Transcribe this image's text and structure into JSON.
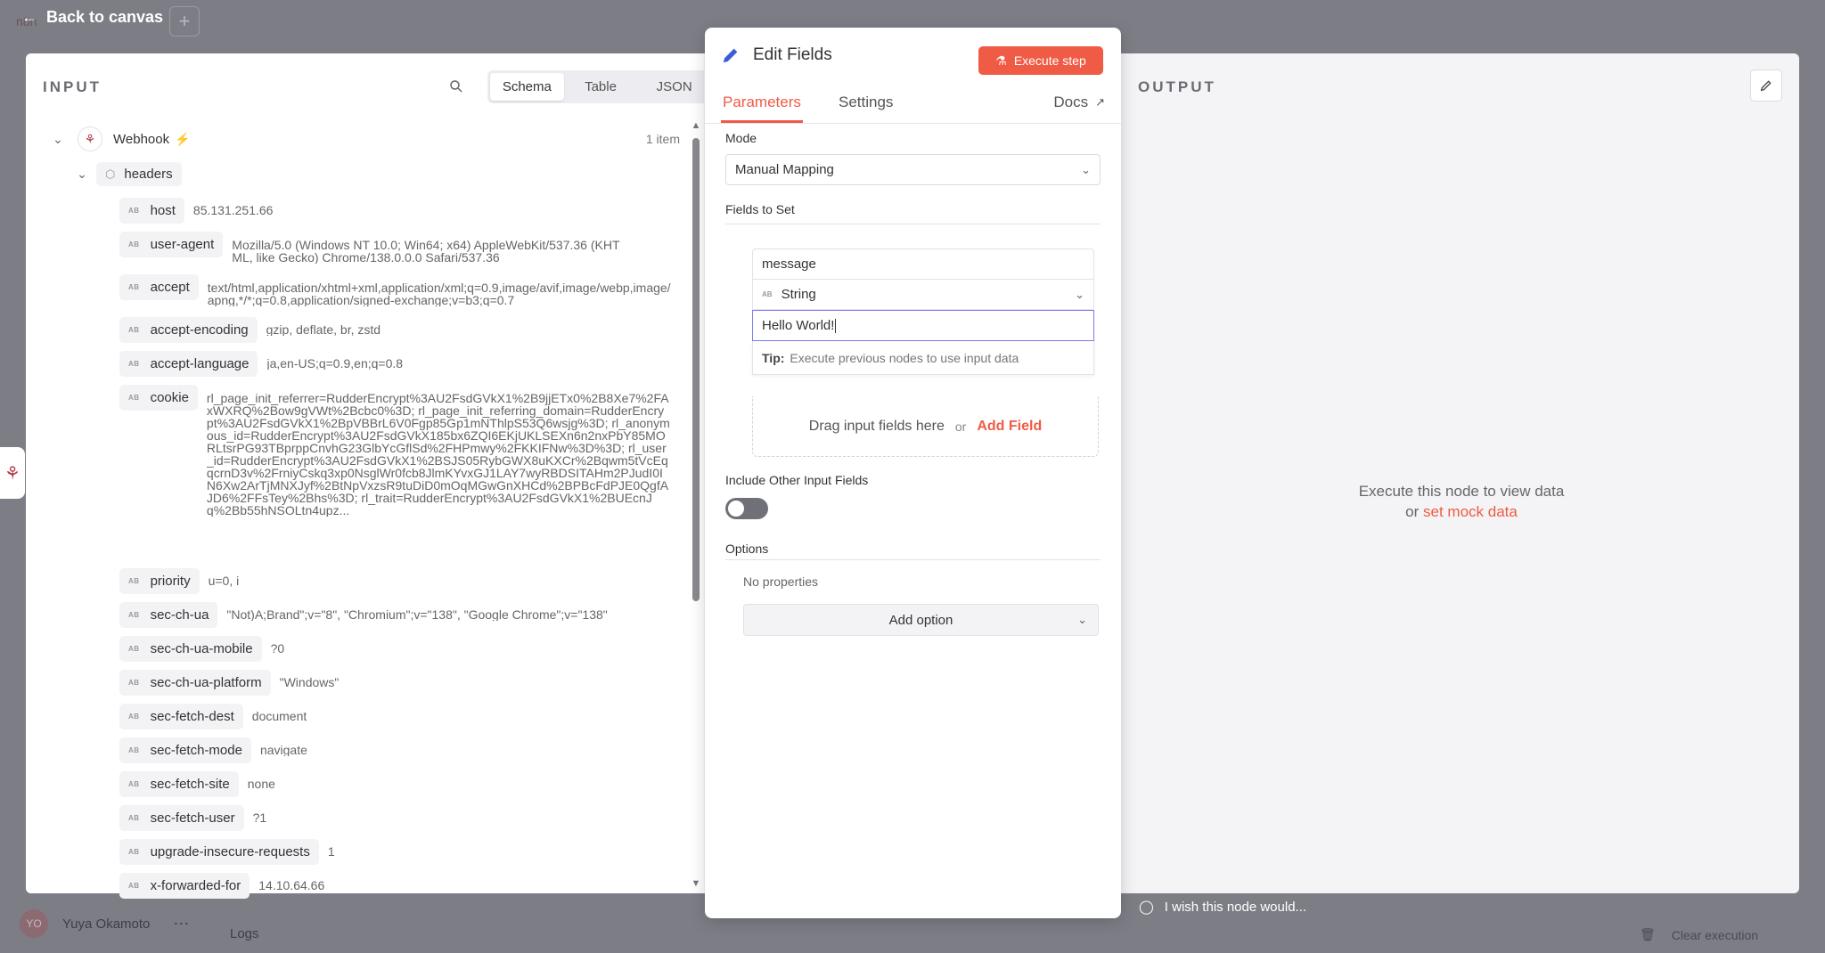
{
  "background": {
    "back_label": "Back to canvas",
    "logo_text": "n8n",
    "user_initials": "YO",
    "user_name": "Yuya Okamoto",
    "logs_label": "Logs",
    "clear_label": "Clear execution"
  },
  "input": {
    "label": "INPUT",
    "modes": [
      "Schema",
      "Table",
      "JSON"
    ],
    "active_mode": "Schema",
    "node_name": "Webhook",
    "item_count": "1 item",
    "headers_label": "headers",
    "type_marker": "AB",
    "fields": [
      {
        "key": "host",
        "value": "85.131.251.66"
      },
      {
        "key": "user-agent",
        "value": "Mozilla/5.0 (Windows NT 10.0; Win64; x64) AppleWebKit/537.36 (KHTML, like Gecko) Chrome/138.0.0.0 Safari/537.36"
      },
      {
        "key": "accept",
        "value": "text/html,application/xhtml+xml,application/xml;q=0.9,image/avif,image/webp,image/apng,*/*;q=0.8,application/signed-exchange;v=b3;q=0.7"
      },
      {
        "key": "accept-encoding",
        "value": "gzip, deflate, br, zstd"
      },
      {
        "key": "accept-language",
        "value": "ja,en-US;q=0.9,en;q=0.8"
      },
      {
        "key": "cookie",
        "value": "rl_page_init_referrer=RudderEncrypt%3AU2FsdGVkX1%2B9jjETx0%2B8Xe7%2FAxWXRQ%2Bow9gVWt%2Bcbc0%3D; rl_page_init_referring_domain=RudderEncrypt%3AU2FsdGVkX1%2BpVBBrL6V0Fgp85Gp1mNThlpS53Q6wsjg%3D; rl_anonymous_id=RudderEncrypt%3AU2FsdGVkX185bx6ZQI6EKjUKLSEXn6n2nxPbY85MORLtsrPG93TBprppCnvhG23GlbYcGflSd%2FHPmwy%2FKKIFNw%3D%3D; rl_user_id=RudderEncrypt%3AU2FsdGVkX1%2BSJS05RybGWX8uKXCr%2Bqwm5tVcEqqcrnD3v%2FrniyCskq3xp0NsglWr0fcb8JlmKYvxGJ1LAY7wyRBDSITAHm2PJudI0IN6Xw2ArTjMNXJyf%2BtNpVxzsR9tuDiD0mOqMGwGnXHCd%2BPBcFdPJE0QgfAJD6%2FFsTey%2Bhs%3D; rl_trait=RudderEncrypt%3AU2FsdGVkX1%2BUEcnJq%2Bb55hNSOLtn4upz..."
      },
      {
        "key": "priority",
        "value": "u=0, i"
      },
      {
        "key": "sec-ch-ua",
        "value": "\"Not)A;Brand\";v=\"8\", \"Chromium\";v=\"138\", \"Google Chrome\";v=\"138\""
      },
      {
        "key": "sec-ch-ua-mobile",
        "value": "?0"
      },
      {
        "key": "sec-ch-ua-platform",
        "value": "\"Windows\""
      },
      {
        "key": "sec-fetch-dest",
        "value": "document"
      },
      {
        "key": "sec-fetch-mode",
        "value": "navigate"
      },
      {
        "key": "sec-fetch-site",
        "value": "none"
      },
      {
        "key": "sec-fetch-user",
        "value": "?1"
      },
      {
        "key": "upgrade-insecure-requests",
        "value": "1"
      },
      {
        "key": "x-forwarded-for",
        "value": "14.10.64.66"
      }
    ]
  },
  "edit": {
    "title": "Edit Fields",
    "execute_label": "Execute step",
    "tabs": [
      "Parameters",
      "Settings"
    ],
    "active_tab": "Parameters",
    "docs_label": "Docs",
    "mode_label": "Mode",
    "mode_value": "Manual Mapping",
    "fields_to_set_label": "Fields to Set",
    "assignment": {
      "name": "message",
      "type": "String",
      "type_marker": "AB",
      "value": "Hello World!",
      "tip_label": "Tip:",
      "tip_text": "Execute previous nodes to use input data"
    },
    "drop_text": "Drag input fields here",
    "or_text": "or",
    "add_field_label": "Add Field",
    "include_other_label": "Include Other Input Fields",
    "include_other_on": false,
    "options_label": "Options",
    "no_properties": "No properties",
    "add_option_label": "Add option"
  },
  "output": {
    "label": "OUTPUT",
    "message": "Execute this node to view data",
    "or_text": "or",
    "mock_link": "set mock data"
  },
  "footer": {
    "wish_text": "I wish this node would..."
  },
  "colors": {
    "accent": "#ef5b45",
    "pencil": "#3b5bd9",
    "webhook": "#b2384a"
  }
}
